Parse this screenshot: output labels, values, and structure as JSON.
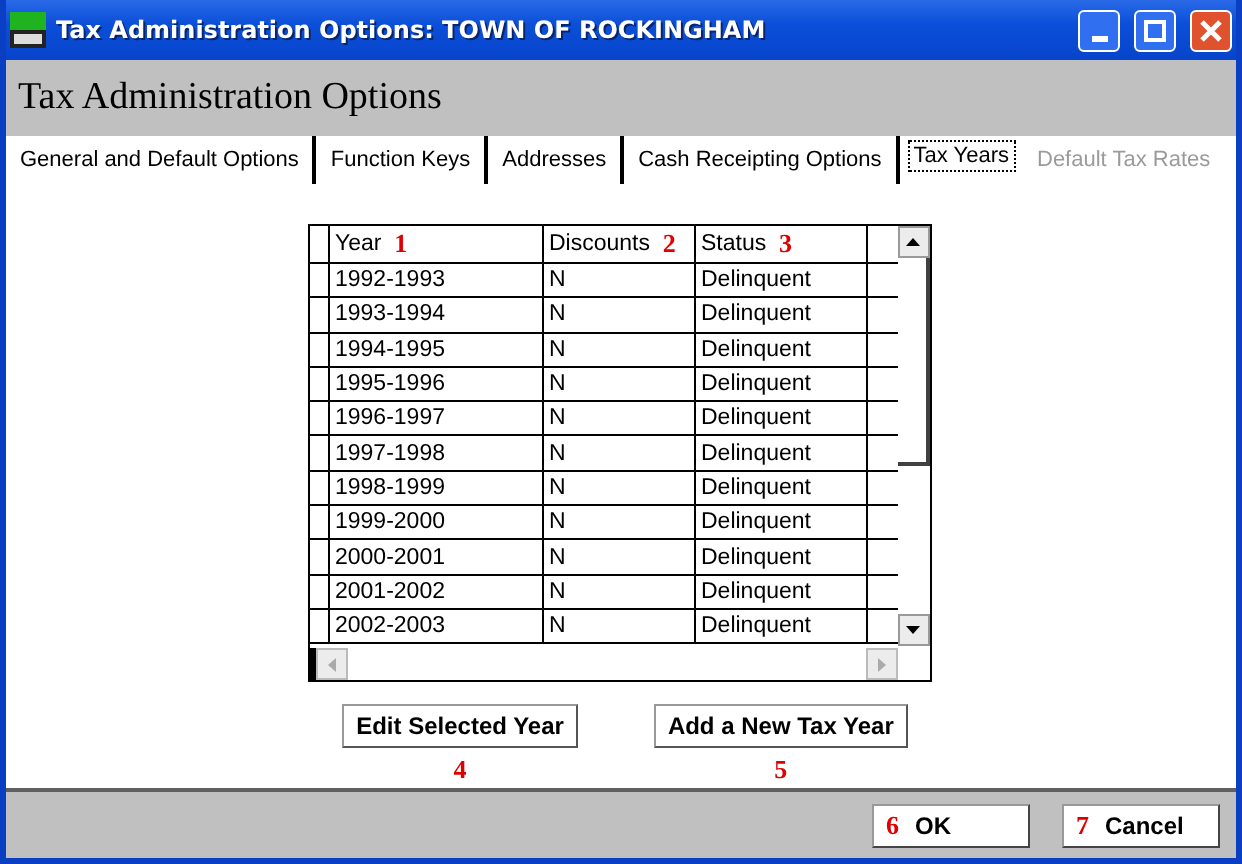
{
  "window": {
    "title": "Tax Administration Options: TOWN OF ROCKINGHAM"
  },
  "header": {
    "title": "Tax Administration Options"
  },
  "tabs": [
    {
      "label": "General and Default Options",
      "selected": false,
      "disabled": false
    },
    {
      "label": "Function Keys",
      "selected": false,
      "disabled": false
    },
    {
      "label": "Addresses",
      "selected": false,
      "disabled": false
    },
    {
      "label": "Cash Receipting Options",
      "selected": false,
      "disabled": false
    },
    {
      "label": "Tax Years",
      "selected": true,
      "disabled": false
    },
    {
      "label": "Default Tax Rates",
      "selected": false,
      "disabled": true
    }
  ],
  "table": {
    "columns": [
      {
        "label": "Year",
        "marker": "1"
      },
      {
        "label": "Discounts",
        "marker": "2"
      },
      {
        "label": "Status",
        "marker": "3"
      }
    ],
    "rows": [
      [
        "1992-1993",
        "N",
        "Delinquent"
      ],
      [
        "1993-1994",
        "N",
        "Delinquent"
      ],
      [
        "1994-1995",
        "N",
        "Delinquent"
      ],
      [
        "1995-1996",
        "N",
        "Delinquent"
      ],
      [
        "1996-1997",
        "N",
        "Delinquent"
      ],
      [
        "1997-1998",
        "N",
        "Delinquent"
      ],
      [
        "1998-1999",
        "N",
        "Delinquent"
      ],
      [
        "1999-2000",
        "N",
        "Delinquent"
      ],
      [
        "2000-2001",
        "N",
        "Delinquent"
      ],
      [
        "2001-2002",
        "N",
        "Delinquent"
      ],
      [
        "2002-2003",
        "N",
        "Delinquent"
      ]
    ]
  },
  "actions": [
    {
      "label": "Edit Selected Year",
      "marker": "4"
    },
    {
      "label": "Add a New Tax Year",
      "marker": "5"
    }
  ],
  "footer": [
    {
      "label": "OK",
      "marker": "6"
    },
    {
      "label": "Cancel",
      "marker": "7"
    }
  ]
}
